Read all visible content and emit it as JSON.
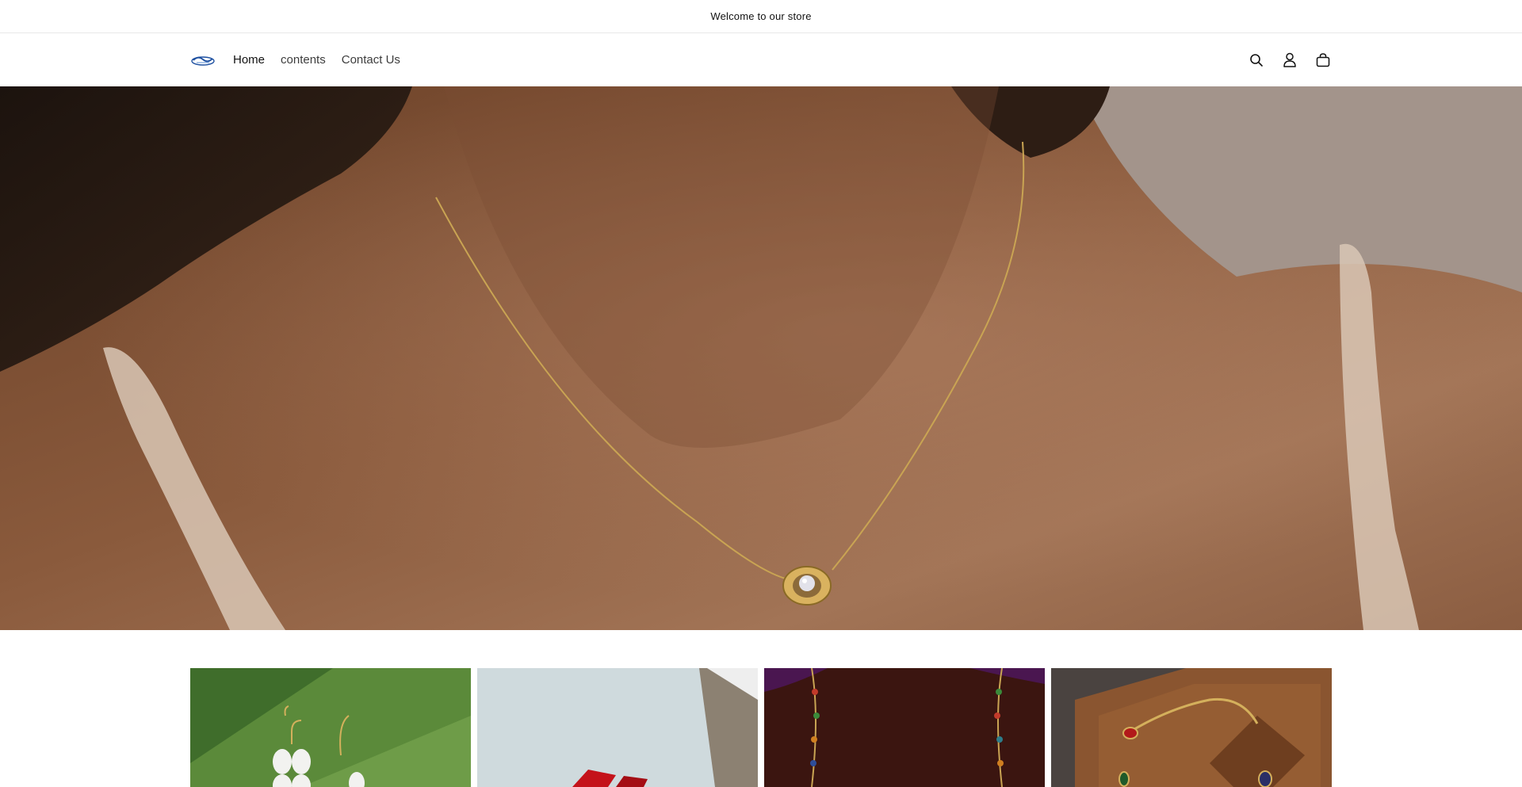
{
  "announcement": {
    "text": "Welcome to our store"
  },
  "header": {
    "logo_icon": "brand-logo",
    "nav": [
      {
        "label": "Home",
        "active": true
      },
      {
        "label": "contents",
        "active": false
      },
      {
        "label": "Contact Us",
        "active": false
      }
    ],
    "icons": [
      "search-icon",
      "account-icon",
      "cart-icon"
    ]
  },
  "hero": {
    "image": "necklace-with-solitaire-pendant-on-model"
  },
  "collections": [
    {
      "image": "white-petal-drop-earrings-on-green"
    },
    {
      "image": "red-jewelry-box-on-light-background"
    },
    {
      "image": "multicolor-stone-necklace-on-model"
    },
    {
      "image": "gold-bracelet-with-gemstones-on-wood"
    }
  ],
  "colors": {
    "text": "#121212",
    "nav_text": "#3d3d3d",
    "border": "#e8e8e8",
    "background": "#ffffff"
  }
}
